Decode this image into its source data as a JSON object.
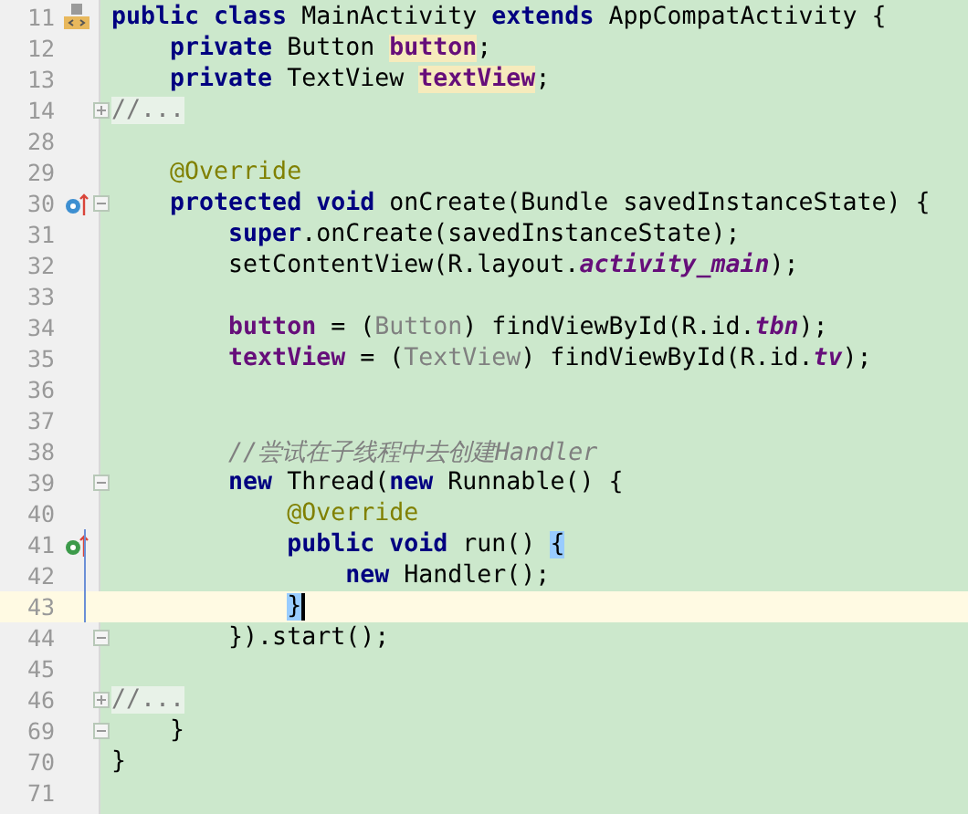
{
  "editor": {
    "lines": [
      {
        "number": "11",
        "current": false,
        "gutter": [
          {
            "kind": "class"
          }
        ],
        "tokens": [
          {
            "text": "public class ",
            "kind": "keyword"
          },
          {
            "text": "MainActivity ",
            "kind": "plain"
          },
          {
            "text": "extends ",
            "kind": "keyword"
          },
          {
            "text": "AppCompatActivity {",
            "kind": "plain"
          }
        ]
      },
      {
        "number": "12",
        "current": false,
        "tokens": [
          {
            "text": "    private ",
            "kind": "keyword"
          },
          {
            "text": "Button ",
            "kind": "plain"
          },
          {
            "text": "button",
            "kind": "field-highlight"
          },
          {
            "text": ";",
            "kind": "plain"
          }
        ]
      },
      {
        "number": "13",
        "current": false,
        "tokens": [
          {
            "text": "    private ",
            "kind": "keyword"
          },
          {
            "text": "TextView ",
            "kind": "plain"
          },
          {
            "text": "textView",
            "kind": "field-highlight"
          },
          {
            "text": ";",
            "kind": "plain"
          }
        ]
      },
      {
        "number": "14",
        "current": false,
        "gutter": [
          {
            "kind": "fold",
            "collapsed": true
          }
        ],
        "tokens": [
          {
            "text": "//...",
            "kind": "folded"
          }
        ]
      },
      {
        "number": "28",
        "current": false
      },
      {
        "number": "29",
        "current": false,
        "tokens": [
          {
            "text": "    @Override",
            "kind": "annotation"
          }
        ]
      },
      {
        "number": "30",
        "current": false,
        "gutter": [
          {
            "kind": "override"
          },
          {
            "kind": "fold",
            "collapsed": false
          }
        ],
        "tokens": [
          {
            "text": "    protected void ",
            "kind": "keyword"
          },
          {
            "text": "onCreate(Bundle savedInstanceState) {",
            "kind": "plain"
          }
        ]
      },
      {
        "number": "31",
        "current": false,
        "tokens": [
          {
            "text": "        super",
            "kind": "keyword"
          },
          {
            "text": ".onCreate(savedInstanceState);",
            "kind": "plain"
          }
        ]
      },
      {
        "number": "32",
        "current": false,
        "tokens": [
          {
            "text": "        setContentView(R.layout.",
            "kind": "plain"
          },
          {
            "text": "activity_main",
            "kind": "static"
          },
          {
            "text": ");",
            "kind": "plain"
          }
        ]
      },
      {
        "number": "33",
        "current": false
      },
      {
        "number": "34",
        "current": false,
        "tokens": [
          {
            "text": "        button",
            "kind": "field"
          },
          {
            "text": " = (",
            "kind": "plain"
          },
          {
            "text": "Button",
            "kind": "cast"
          },
          {
            "text": ") findViewById(R.id.",
            "kind": "plain"
          },
          {
            "text": "tbn",
            "kind": "static"
          },
          {
            "text": ");",
            "kind": "plain"
          }
        ]
      },
      {
        "number": "35",
        "current": false,
        "tokens": [
          {
            "text": "        textView",
            "kind": "field"
          },
          {
            "text": " = (",
            "kind": "plain"
          },
          {
            "text": "TextView",
            "kind": "cast"
          },
          {
            "text": ") findViewById(R.id.",
            "kind": "plain"
          },
          {
            "text": "tv",
            "kind": "static"
          },
          {
            "text": ");",
            "kind": "plain"
          }
        ]
      },
      {
        "number": "36",
        "current": false
      },
      {
        "number": "37",
        "current": false
      },
      {
        "number": "38",
        "current": false,
        "tokens": [
          {
            "text": "        //尝试在子线程中去创建Handler",
            "kind": "comment"
          }
        ]
      },
      {
        "number": "39",
        "current": false,
        "gutter": [
          {
            "kind": "fold",
            "collapsed": false
          }
        ],
        "tokens": [
          {
            "text": "        new ",
            "kind": "keyword"
          },
          {
            "text": "Thread(",
            "kind": "plain"
          },
          {
            "text": "new ",
            "kind": "keyword"
          },
          {
            "text": "Runnable() {",
            "kind": "plain"
          }
        ]
      },
      {
        "number": "40",
        "current": false,
        "tokens": [
          {
            "text": "            @Override",
            "kind": "annotation"
          }
        ]
      },
      {
        "number": "41",
        "current": false,
        "gutter": [
          {
            "kind": "implement"
          }
        ],
        "changed": true,
        "tokens": [
          {
            "text": "            public void ",
            "kind": "keyword"
          },
          {
            "text": "run() ",
            "kind": "plain"
          },
          {
            "text": "{",
            "kind": "brace-match"
          }
        ]
      },
      {
        "number": "42",
        "current": false,
        "changed": true,
        "tokens": [
          {
            "text": "                new ",
            "kind": "keyword"
          },
          {
            "text": "Handler();",
            "kind": "plain"
          }
        ]
      },
      {
        "number": "43",
        "current": true,
        "changed": true,
        "tokens": [
          {
            "text": "            }",
            "kind": "brace-match"
          }
        ]
      },
      {
        "number": "44",
        "current": false,
        "gutter": [
          {
            "kind": "fold",
            "collapsed": false
          }
        ],
        "tokens": [
          {
            "text": "        }).start();",
            "kind": "plain"
          }
        ]
      },
      {
        "number": "45",
        "current": false
      },
      {
        "number": "46",
        "current": false,
        "gutter": [
          {
            "kind": "fold",
            "collapsed": true
          }
        ],
        "tokens": [
          {
            "text": "//...",
            "kind": "folded"
          }
        ]
      },
      {
        "number": "69",
        "current": false,
        "gutter": [
          {
            "kind": "fold",
            "collapsed": false
          }
        ],
        "tokens": [
          {
            "text": "    }",
            "kind": "plain"
          }
        ]
      },
      {
        "number": "70",
        "current": false,
        "tokens": [
          {
            "text": "}",
            "kind": "plain"
          }
        ]
      },
      {
        "number": "71",
        "current": false
      }
    ]
  }
}
